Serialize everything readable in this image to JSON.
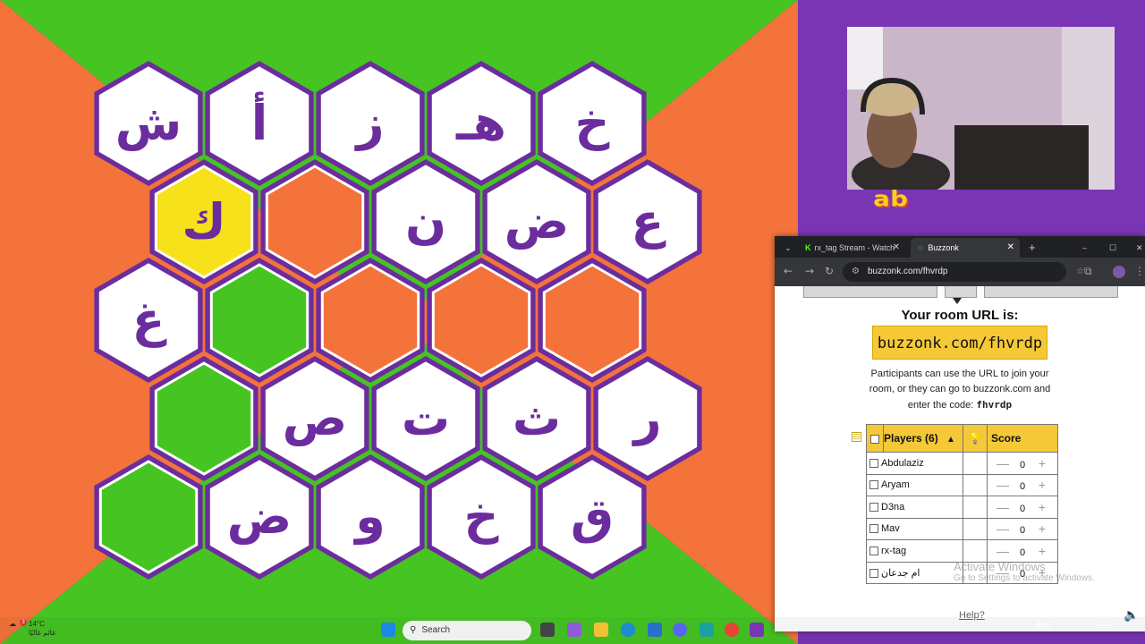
{
  "game": {
    "colors": {
      "orange": "#f4733a",
      "green": "#45c422",
      "purple": "#6b2d9e",
      "white": "#ffffff",
      "yellow": "#f7e11b"
    },
    "rows": [
      [
        "ش",
        "أ",
        "ز",
        "هـ",
        "خ"
      ],
      [
        "ك",
        "",
        "ن",
        "ض",
        "ع"
      ],
      [
        "غ",
        "",
        "",
        "",
        ""
      ],
      [
        "",
        "ص",
        "ت",
        "ث",
        "ر"
      ],
      [
        "",
        "ض",
        "و",
        "خ",
        "ق"
      ]
    ],
    "row_colors": [
      [
        "white",
        "white",
        "white",
        "white",
        "white"
      ],
      [
        "yellow",
        "orange",
        "white",
        "white",
        "white"
      ],
      [
        "white",
        "green",
        "orange",
        "orange",
        "orange"
      ],
      [
        "green",
        "white",
        "white",
        "white",
        "white"
      ],
      [
        "green",
        "white",
        "white",
        "white",
        "white"
      ]
    ]
  },
  "browser": {
    "tabs": [
      {
        "label": "rx_tag Stream - Watch",
        "close": "✕"
      },
      {
        "label": "Buzzonk",
        "close": "✕"
      }
    ],
    "new_tab": "+",
    "window_controls": {
      "minimize": "–",
      "maximize": "☐",
      "close": "✕"
    },
    "url": "buzzonk.com/fhvrdp",
    "page": {
      "room_title": "Your room URL is:",
      "room_url": "buzzonk.com/fhvrdp",
      "desc_text": "Participants can use the URL to join your room, or they can go to buzzonk.com and enter the code:",
      "code": "fhvrdp",
      "players_header": "Players (6)",
      "sort_glyph": "▲",
      "score_header": "Score",
      "collapse_glyph": "⊟",
      "players": [
        {
          "name": "Abdulaziz",
          "score": "0"
        },
        {
          "name": "Aryam",
          "score": "0"
        },
        {
          "name": "D3na",
          "score": "0"
        },
        {
          "name": "Mav",
          "score": "0"
        },
        {
          "name": "rx-tag",
          "score": "0"
        },
        {
          "name": "ام جدعان",
          "score": "0"
        }
      ],
      "minus": "—",
      "plus": "+",
      "help": "Help?"
    }
  },
  "watermark": {
    "title": "Activate Windows",
    "subtitle": "Go to Settings to activate Windows."
  },
  "taskbar": {
    "weather_temp": "14°C",
    "weather_desc": "غائم غالبًا",
    "weather_badge": "3",
    "search_placeholder": "Search",
    "language": "ENG",
    "time": "11:51"
  }
}
